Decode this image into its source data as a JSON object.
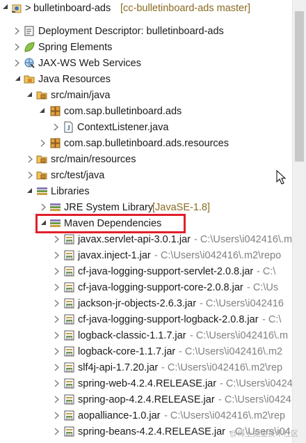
{
  "colors": {
    "highlight": "#e0202a",
    "decoration": "#8a6a20",
    "path_text": "#808080"
  },
  "project": {
    "prefix": ">",
    "name": "bulletinboard-ads",
    "decoration": "[cc-bulletinboard-ads master]"
  },
  "nodes": {
    "deployment": {
      "label": "Deployment Descriptor: bulletinboard-ads"
    },
    "spring": {
      "label": "Spring Elements"
    },
    "jaxws": {
      "label": "JAX-WS Web Services"
    },
    "java_resources": {
      "label": "Java Resources"
    },
    "src_main_java": {
      "label": "src/main/java"
    },
    "pkg_ads": {
      "label": "com.sap.bulletinboard.ads"
    },
    "context_listener": {
      "label": "ContextListener.java"
    },
    "pkg_ads_resources": {
      "label": "com.sap.bulletinboard.ads.resources"
    },
    "src_main_resources": {
      "label": "src/main/resources"
    },
    "src_test_java": {
      "label": "src/test/java"
    },
    "libraries": {
      "label": "Libraries"
    },
    "jre": {
      "label": "JRE System Library",
      "decoration": "[JavaSE-1.8]"
    },
    "maven": {
      "label": "Maven Dependencies"
    }
  },
  "jars": [
    {
      "name": "javax.servlet-api-3.0.1.jar",
      "path": "- C:\\Users\\i042416\\.m"
    },
    {
      "name": "javax.inject-1.jar",
      "path": "- C:\\Users\\i042416\\.m2\\repo"
    },
    {
      "name": "cf-java-logging-support-servlet-2.0.8.jar",
      "path": "- C:\\"
    },
    {
      "name": "cf-java-logging-support-core-2.0.8.jar",
      "path": "- C:\\Us"
    },
    {
      "name": "jackson-jr-objects-2.6.3.jar",
      "path": "- C:\\Users\\i042416"
    },
    {
      "name": "cf-java-logging-support-logback-2.0.8.jar",
      "path": "- C:\\"
    },
    {
      "name": "logback-classic-1.1.7.jar",
      "path": "- C:\\Users\\i042416\\.m"
    },
    {
      "name": "logback-core-1.1.7.jar",
      "path": "- C:\\Users\\i042416\\.m2"
    },
    {
      "name": "slf4j-api-1.7.20.jar",
      "path": "- C:\\Users\\i042416\\.m2\\rep"
    },
    {
      "name": "spring-web-4.2.4.RELEASE.jar",
      "path": "- C:\\Users\\i0424"
    },
    {
      "name": "spring-aop-4.2.4.RELEASE.jar",
      "path": "- C:\\Users\\i0424"
    },
    {
      "name": "aopalliance-1.0.jar",
      "path": "- C:\\Users\\i042416\\.m2\\rep"
    },
    {
      "name": "spring-beans-4.2.4.RELEASE.jar",
      "path": "- C:\\Users\\i04"
    }
  ],
  "watermark": "@稀土掘金技术社区"
}
